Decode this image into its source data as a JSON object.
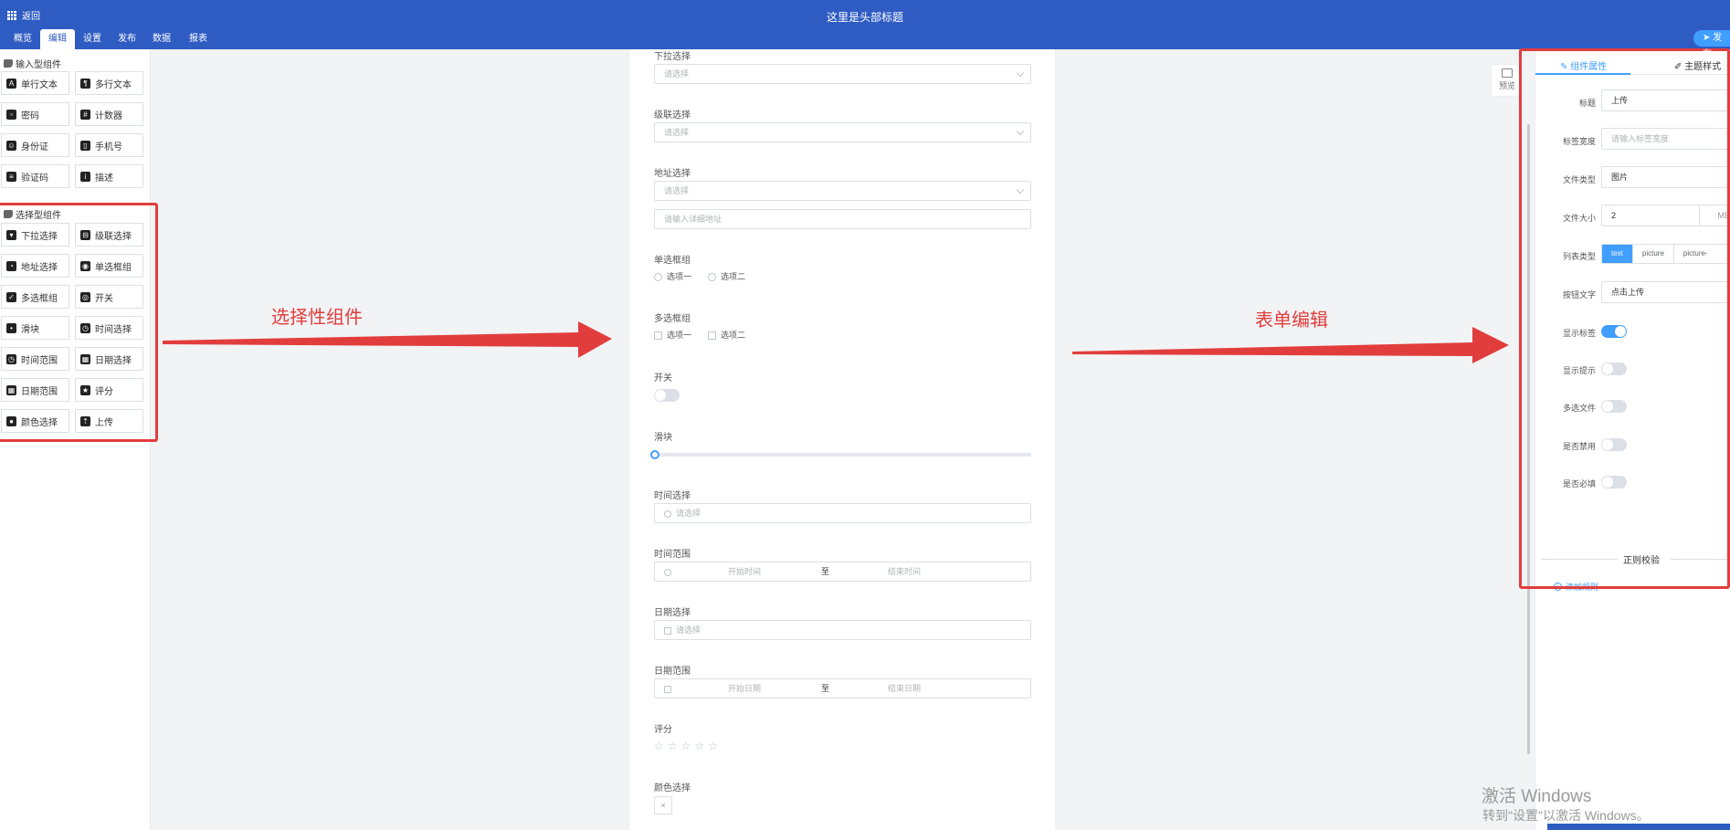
{
  "header": {
    "back_label": "返回",
    "title": "这里是头部标题",
    "publish_label": "发布"
  },
  "tabs": [
    {
      "label": "概览"
    },
    {
      "label": "编辑"
    },
    {
      "label": "设置"
    },
    {
      "label": "发布"
    },
    {
      "label": "数据"
    },
    {
      "label": "报表"
    }
  ],
  "palette": {
    "input_group": {
      "title": "输入型组件",
      "items": [
        {
          "label": "单行文本",
          "icon": "text-A-icon"
        },
        {
          "label": "多行文本",
          "icon": "paragraph-icon"
        },
        {
          "label": "密码",
          "icon": "lock-icon"
        },
        {
          "label": "计数器",
          "icon": "counter-icon"
        },
        {
          "label": "身份证",
          "icon": "id-card-icon"
        },
        {
          "label": "手机号",
          "icon": "phone-icon"
        },
        {
          "label": "验证码",
          "icon": "code-icon"
        },
        {
          "label": "描述",
          "icon": "info-icon"
        }
      ]
    },
    "select_group": {
      "title": "选择型组件",
      "items": [
        {
          "label": "下拉选择",
          "icon": "dropdown-icon"
        },
        {
          "label": "级联选择",
          "icon": "cascader-icon"
        },
        {
          "label": "地址选择",
          "icon": "address-icon"
        },
        {
          "label": "单选框组",
          "icon": "radio-icon"
        },
        {
          "label": "多选框组",
          "icon": "checkbox-icon"
        },
        {
          "label": "开关",
          "icon": "switch-icon"
        },
        {
          "label": "滑块",
          "icon": "slider-icon"
        },
        {
          "label": "时间选择",
          "icon": "clock-icon"
        },
        {
          "label": "时间范围",
          "icon": "clock-range-icon"
        },
        {
          "label": "日期选择",
          "icon": "calendar-icon"
        },
        {
          "label": "日期范围",
          "icon": "calendar-range-icon"
        },
        {
          "label": "评分",
          "icon": "star-icon"
        },
        {
          "label": "颜色选择",
          "icon": "palette-icon"
        },
        {
          "label": "上传",
          "icon": "upload-icon"
        }
      ]
    }
  },
  "form": {
    "dropdown": {
      "label": "下拉选择",
      "placeholder": "请选择"
    },
    "cascader": {
      "label": "级联选择",
      "placeholder": "请选择"
    },
    "address": {
      "label": "地址选择",
      "placeholder": "请选择",
      "detail_placeholder": "请输入详细地址"
    },
    "radio": {
      "label": "单选框组",
      "options": [
        "选项一",
        "选项二"
      ]
    },
    "checkbox": {
      "label": "多选框组",
      "options": [
        "选项一",
        "选项二"
      ]
    },
    "switch": {
      "label": "开关"
    },
    "slider": {
      "label": "滑块",
      "value": 0
    },
    "time": {
      "label": "时间选择",
      "placeholder": "请选择"
    },
    "time_range": {
      "label": "时间范围",
      "start": "开始时间",
      "sep": "至",
      "end": "结束时间"
    },
    "date": {
      "label": "日期选择",
      "placeholder": "请选择"
    },
    "date_range": {
      "label": "日期范围",
      "start": "开始日期",
      "sep": "至",
      "end": "结束日期"
    },
    "rate": {
      "label": "评分",
      "stars": 5,
      "value": 0
    },
    "color": {
      "label": "颜色选择",
      "clear_glyph": "×"
    }
  },
  "preview_label": "预览",
  "props": {
    "tab_component": "组件属性",
    "tab_theme": "主题样式",
    "title": {
      "label": "标题",
      "value": "上传"
    },
    "label_width": {
      "label": "标签宽度",
      "placeholder": "请输入标签宽度"
    },
    "file_type": {
      "label": "文件类型",
      "value": "图片"
    },
    "file_size": {
      "label": "文件大小",
      "value": "2",
      "unit": "MB"
    },
    "list_type": {
      "label": "列表类型",
      "options": [
        "text",
        "picture",
        "picture-card"
      ],
      "selected": "text"
    },
    "button_text": {
      "label": "按钮文字",
      "value": "点击上传"
    },
    "show_label": {
      "label": "显示标签",
      "on": true
    },
    "show_tip": {
      "label": "显示提示",
      "on": false
    },
    "multiple": {
      "label": "多选文件",
      "on": false
    },
    "disabled": {
      "label": "是否禁用",
      "on": false
    },
    "required": {
      "label": "是否必填",
      "on": false
    },
    "regex_title": "正则校验",
    "add_rule": "添加规则"
  },
  "annotations": {
    "select_components": "选择性组件",
    "form_edit": "表单编辑"
  },
  "watermark": {
    "line1": "激活 Windows",
    "line2": "转到\"设置\"以激活 Windows。"
  },
  "colors": {
    "header": "#2f5cc3",
    "accent": "#409eff",
    "annotation": "#e23d3d"
  }
}
